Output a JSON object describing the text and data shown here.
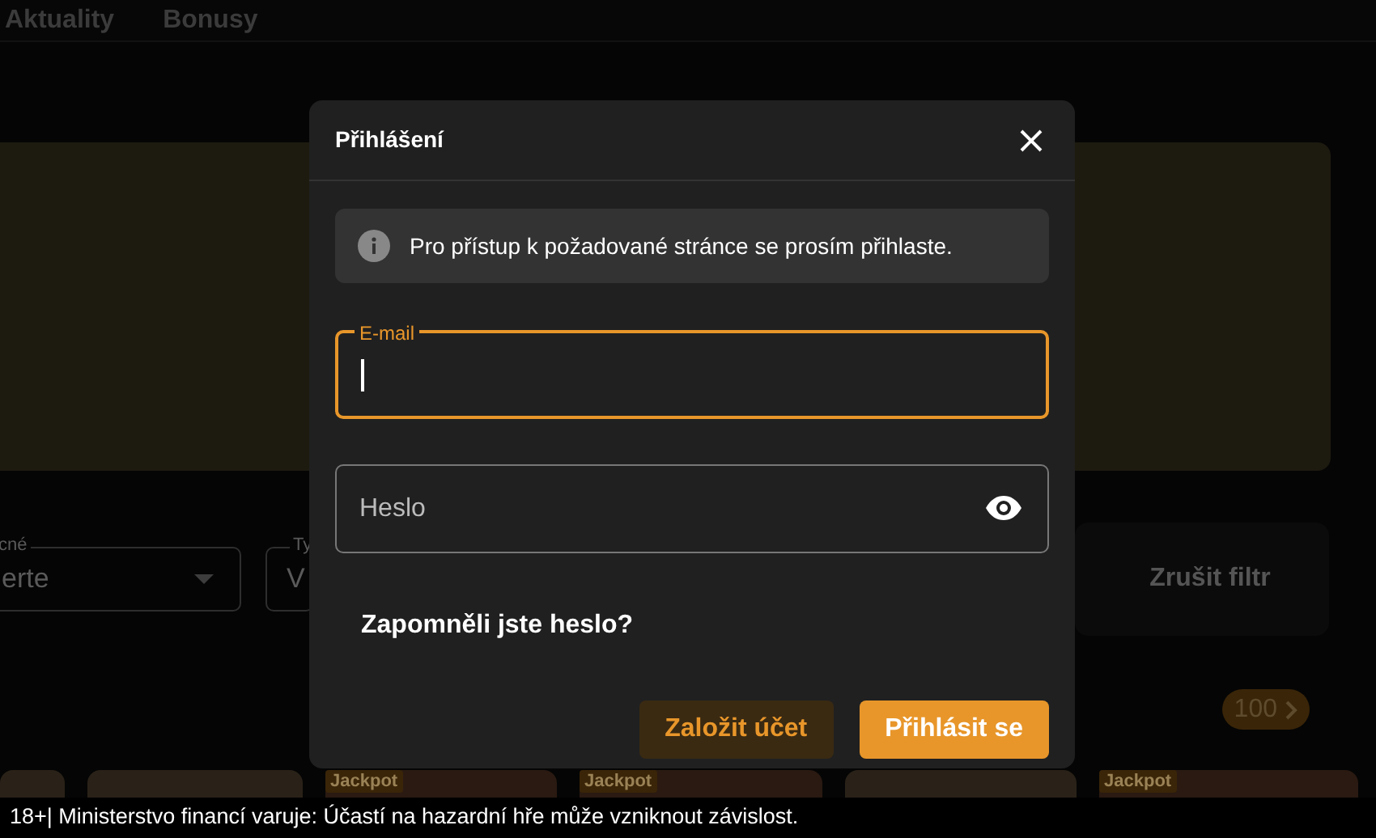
{
  "nav": {
    "items": [
      "Aktuality",
      "Bonusy"
    ]
  },
  "filters": [
    {
      "label": "cné",
      "value": "erte"
    },
    {
      "label": "Ty",
      "value": "V"
    }
  ],
  "clear_filter": "Zrušit filtr",
  "game_count": "100",
  "games": [
    {
      "kind": "plain"
    },
    {
      "kind": "plain"
    },
    {
      "kind": "jackpot",
      "badge": "Jackpot"
    },
    {
      "kind": "jackpot",
      "badge": "Jackpot"
    },
    {
      "kind": "plain"
    },
    {
      "kind": "jackpot",
      "badge": "Jackpot"
    }
  ],
  "modal": {
    "title": "Přihlášení",
    "info": "Pro přístup k požadované stránce se prosím přihlaste.",
    "email": {
      "label": "E-mail",
      "focused": true
    },
    "password": {
      "placeholder": "Heslo"
    },
    "forgot": "Zapomněli jste heslo?",
    "buttons": [
      {
        "label": "Založit účet",
        "kind": "secondary"
      },
      {
        "label": "Přihlásit se",
        "kind": "primary"
      }
    ]
  },
  "footer": "18+| Ministerstvo financí varuje: Účastí na hazardní hře může vzniknout závislost."
}
